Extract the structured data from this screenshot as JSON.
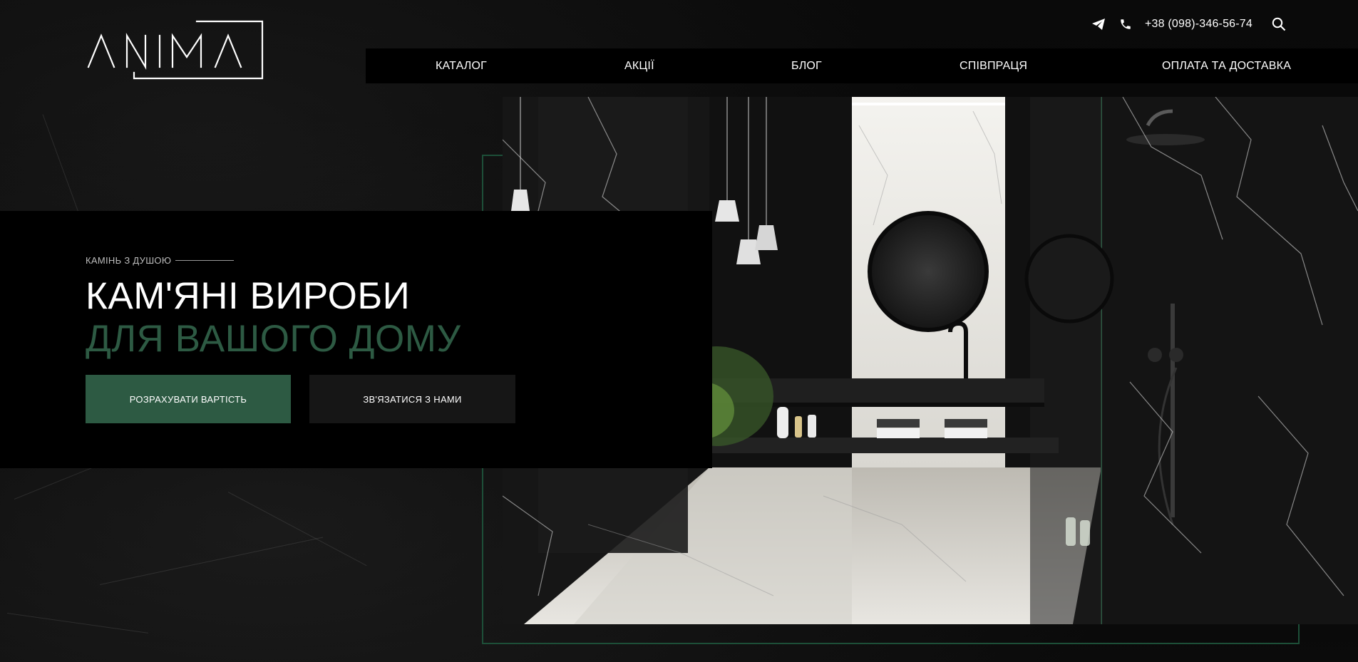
{
  "brand": {
    "logo_text": "ANIMA",
    "accent_color": "#2d5a43",
    "frame_color": "#1d4f38"
  },
  "header": {
    "telegram_icon": "telegram-icon",
    "phone_icon": "phone-icon",
    "phone": "+38 (098)-346-56-74",
    "search_icon": "search-icon"
  },
  "nav": {
    "items": [
      {
        "label": "КАТАЛОГ"
      },
      {
        "label": "АКЦІЇ"
      },
      {
        "label": "БЛОГ"
      },
      {
        "label": "СПІВПРАЦЯ"
      },
      {
        "label": "ОПЛАТА ТА ДОСТАВКА"
      }
    ]
  },
  "hero": {
    "eyebrow": "КАМІНЬ З ДУШОЮ",
    "title_line1": "КАМ'ЯНІ ВИРОБИ",
    "title_line2": "ДЛЯ ВАШОГО ДОМУ",
    "primary_button": "РОЗРАХУВАТИ ВАРТІСТЬ",
    "secondary_button": "ЗВ'ЯЗАТИСЯ З НАМИ"
  }
}
